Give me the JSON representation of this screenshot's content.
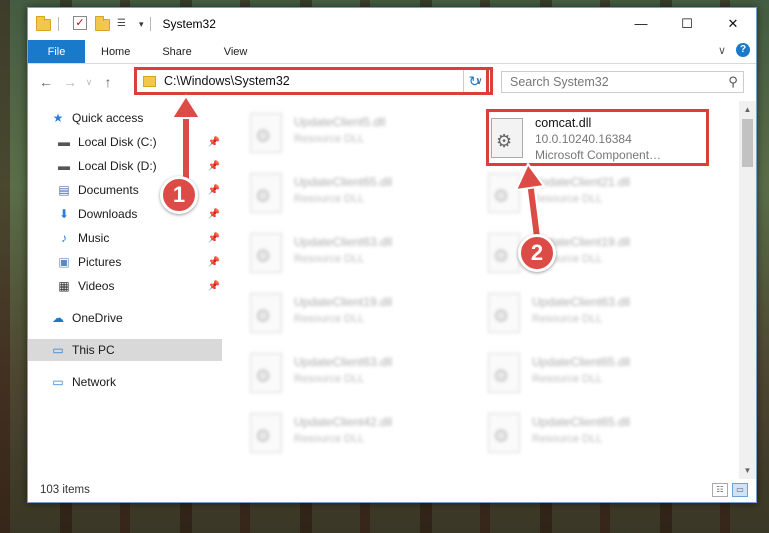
{
  "window": {
    "title": "System32",
    "min_glyph": "—",
    "max_glyph": "☐",
    "close_glyph": "✕"
  },
  "ribbon": {
    "tabs": [
      "File",
      "Home",
      "Share",
      "View"
    ],
    "chev": "∨",
    "help": "?"
  },
  "address": {
    "path": "C:\\Windows\\System32",
    "back": "←",
    "forward": "→",
    "recent": "∨",
    "up": "↑",
    "dropdown": "∨",
    "refresh": "↻"
  },
  "search": {
    "placeholder": "Search System32",
    "icon_glyph": "⚲"
  },
  "navigation": [
    {
      "label": "Quick access",
      "icon": "star-icon",
      "glyph": "★",
      "color": "#2b7fd8",
      "pinned": false
    },
    {
      "label": "Local Disk (C:)",
      "icon": "drive-icon",
      "glyph": "▬",
      "color": "#555555",
      "pinned": true
    },
    {
      "label": "Local Disk (D:)",
      "icon": "drive-icon",
      "glyph": "▬",
      "color": "#555555",
      "pinned": true
    },
    {
      "label": "Documents",
      "icon": "documents-icon",
      "glyph": "▤",
      "color": "#4a6c9e",
      "pinned": true
    },
    {
      "label": "Downloads",
      "icon": "downloads-icon",
      "glyph": "⬇",
      "color": "#2b7fd8",
      "pinned": true
    },
    {
      "label": "Music",
      "icon": "music-icon",
      "glyph": "♪",
      "color": "#2b7fd8",
      "pinned": true
    },
    {
      "label": "Pictures",
      "icon": "pictures-icon",
      "glyph": "▣",
      "color": "#5a8ab8",
      "pinned": true
    },
    {
      "label": "Videos",
      "icon": "videos-icon",
      "glyph": "▦",
      "color": "#333333",
      "pinned": true
    },
    {
      "label": "OneDrive",
      "icon": "onedrive-icon",
      "glyph": "☁",
      "color": "#1979ca",
      "pinned": false
    },
    {
      "label": "This PC",
      "icon": "computer-icon",
      "glyph": "▭",
      "color": "#2b7fd8",
      "pinned": false
    },
    {
      "label": "Network",
      "icon": "network-icon",
      "glyph": "▭",
      "color": "#2b7fd8",
      "pinned": false
    }
  ],
  "pin_glyph": "📌",
  "files_left": [
    {
      "name": "UpdateClient5.dll",
      "desc": "Resource DLL"
    },
    {
      "name": "UpdateClient65.dll",
      "desc": "Resource DLL"
    },
    {
      "name": "UpdateClient63.dll",
      "desc": "Resource DLL"
    },
    {
      "name": "UpdateClient19.dll",
      "desc": "Resource DLL"
    },
    {
      "name": "UpdateClient63.dll",
      "desc": "Resource DLL"
    },
    {
      "name": "UpdateClient42.dll",
      "desc": "Resource DLL"
    }
  ],
  "files_right": [
    {
      "name": "UpdateClient21.dll",
      "desc": "Resource DLL"
    },
    {
      "name": "UpdateClient19.dll",
      "desc": "Resource DLL"
    },
    {
      "name": "UpdateClient63.dll",
      "desc": "Resource DLL"
    },
    {
      "name": "UpdateClient65.dll",
      "desc": "Resource DLL"
    },
    {
      "name": "UpdateClient65.dll",
      "desc": "Resource DLL"
    }
  ],
  "highlighted_file": {
    "name": "comcat.dll",
    "version": "10.0.10240.16384",
    "company": "Microsoft Component…"
  },
  "status": {
    "items": "103 items",
    "details_glyph": "☷",
    "tiles_glyph": "▭"
  },
  "scroll": {
    "up": "▲",
    "down": "▼"
  },
  "callouts": [
    "1",
    "2"
  ],
  "colors": {
    "accent": "#1979ca",
    "highlight_red": "#d9403a",
    "callout_red": "#dc4b46"
  }
}
